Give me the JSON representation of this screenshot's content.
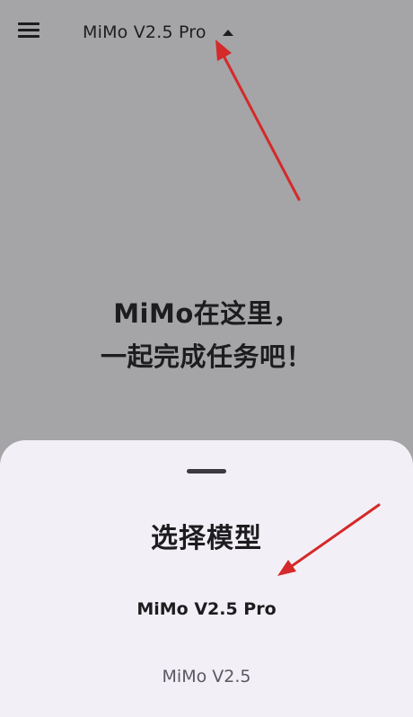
{
  "header": {
    "model_title": "MiMo V2.5 Pro",
    "menu_icon": "hamburger-menu-icon",
    "dropdown_icon": "caret-up-icon"
  },
  "welcome": {
    "line1": "MiMo在这里，",
    "line2": "一起完成任务吧！"
  },
  "model_sheet": {
    "title": "选择模型",
    "options": [
      {
        "label": "MiMo V2.5 Pro",
        "selected": true
      },
      {
        "label": "MiMo V2.5",
        "selected": false
      }
    ]
  },
  "colors": {
    "backdrop": "#a5a4a6",
    "sheet_background": "#f3eff6",
    "annotation_arrow": "#d42a2a",
    "text_primary": "#1d1d1f",
    "text_secondary": "#5a5860"
  }
}
